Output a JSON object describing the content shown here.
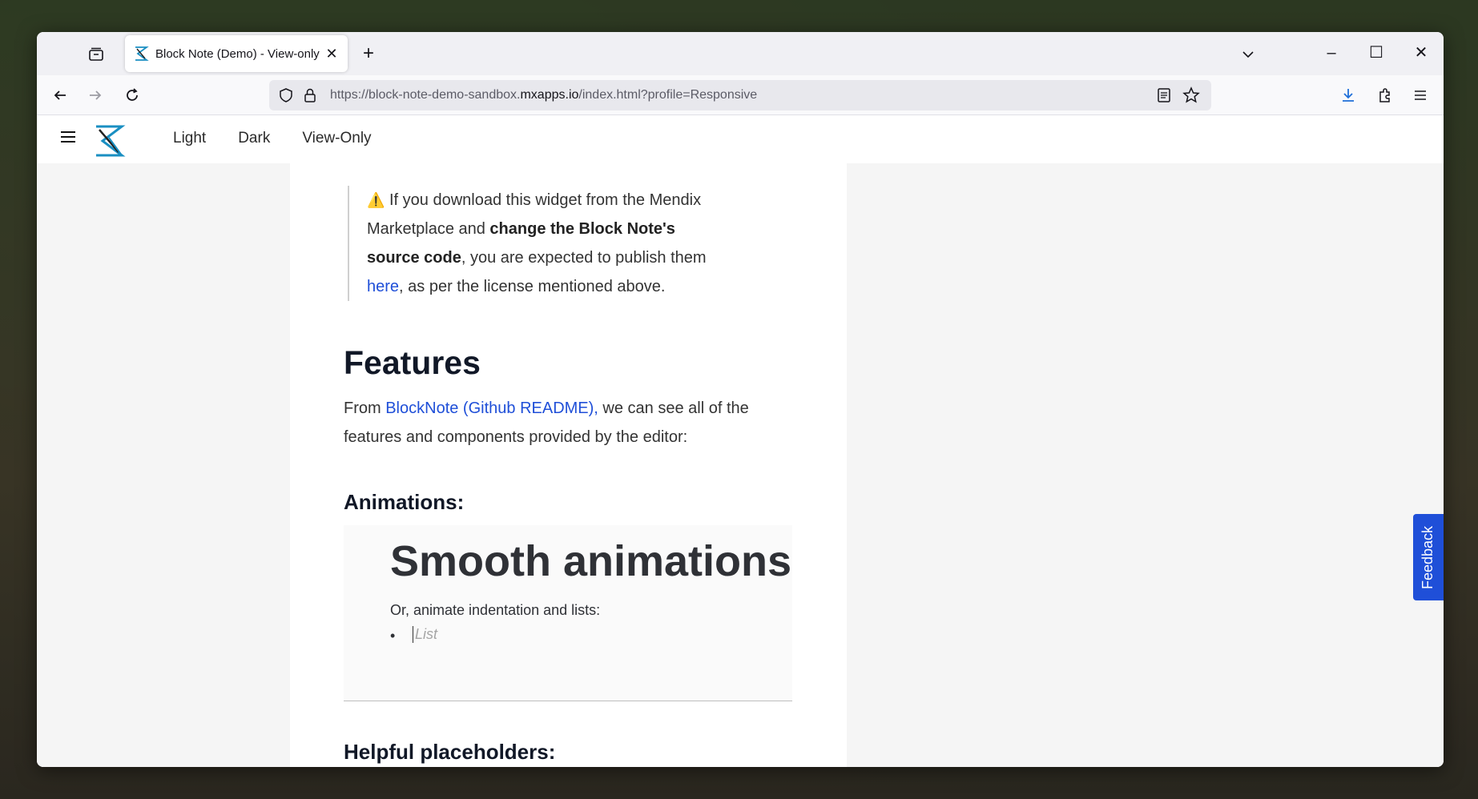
{
  "browser": {
    "tab_title": "Block Note (Demo) - View-only",
    "url_prefix": "https://block-note-demo-sandbox.",
    "url_domain": "mxapps.io",
    "url_suffix": "/index.html?profile=Responsive"
  },
  "appbar": {
    "nav": [
      "Light",
      "Dark",
      "View-Only"
    ]
  },
  "callout": {
    "warning_icon": "⚠️",
    "text1": " If you download this widget from the Mendix Marketplace and ",
    "bold": "change the Block Note's source code",
    "text2": ", you are expected to publish them ",
    "link": "here",
    "text3": ", as per the license mentioned above."
  },
  "features": {
    "heading": "Features",
    "text_prefix": "From ",
    "link": "BlockNote (Github README),",
    "text_suffix": " we can see all of the features and components  provided by the editor:"
  },
  "animations": {
    "heading": "Animations:",
    "demo_title": "Smooth animations",
    "demo_sub": "Or, animate indentation and lists:",
    "bullet": "•",
    "list_placeholder": "List"
  },
  "helpful": {
    "heading": "Helpful placeholders:"
  },
  "feedback_label": "Feedback",
  "colors": {
    "accent": "#1f4fd8",
    "heading": "#111827"
  }
}
